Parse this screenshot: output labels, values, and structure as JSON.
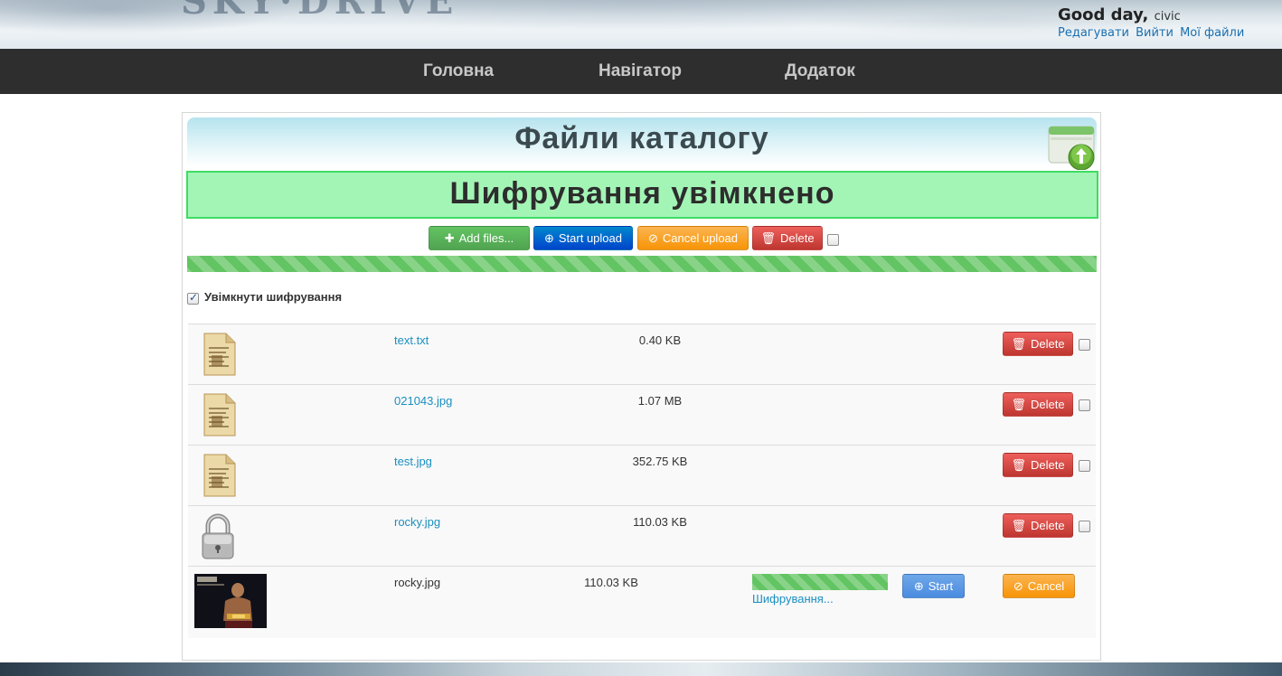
{
  "header": {
    "greeting": "Good day,",
    "username": "civic",
    "links": [
      "Редагувати",
      "Вийти",
      "Мої файли"
    ]
  },
  "nav": {
    "items": [
      "Головна",
      "Навігатор",
      "Додаток"
    ]
  },
  "catalog": {
    "title": "Файли каталогу",
    "encryption_banner": "Шифрування увімкнено"
  },
  "toolbar": {
    "add_files": "Add files...",
    "start_upload": "Start upload",
    "cancel_upload": "Cancel upload",
    "delete": "Delete"
  },
  "encryption_toggle": {
    "label": "Увімкнути шифрування",
    "checked": true
  },
  "files": [
    {
      "name": "text.txt",
      "size": "0.40 KB",
      "icon": "document-icon",
      "action": "Delete"
    },
    {
      "name": "021043.jpg",
      "size": "1.07 MB",
      "icon": "document-icon",
      "action": "Delete"
    },
    {
      "name": "test.jpg",
      "size": "352.75 KB",
      "icon": "document-icon",
      "action": "Delete"
    },
    {
      "name": "rocky.jpg",
      "size": "110.03 KB",
      "icon": "lock-icon",
      "action": "Delete"
    }
  ],
  "pending_upload": {
    "name": "rocky.jpg",
    "size": "110.03 KB",
    "status": "Шифрування...",
    "progress": 1.0,
    "start_label": "Start",
    "cancel_label": "Cancel"
  },
  "colors": {
    "nav_bg": "#2e2e2e",
    "banner_green": "#a3f5b6",
    "link_blue": "#1a8fbf",
    "delete_red": "#bd362f"
  }
}
